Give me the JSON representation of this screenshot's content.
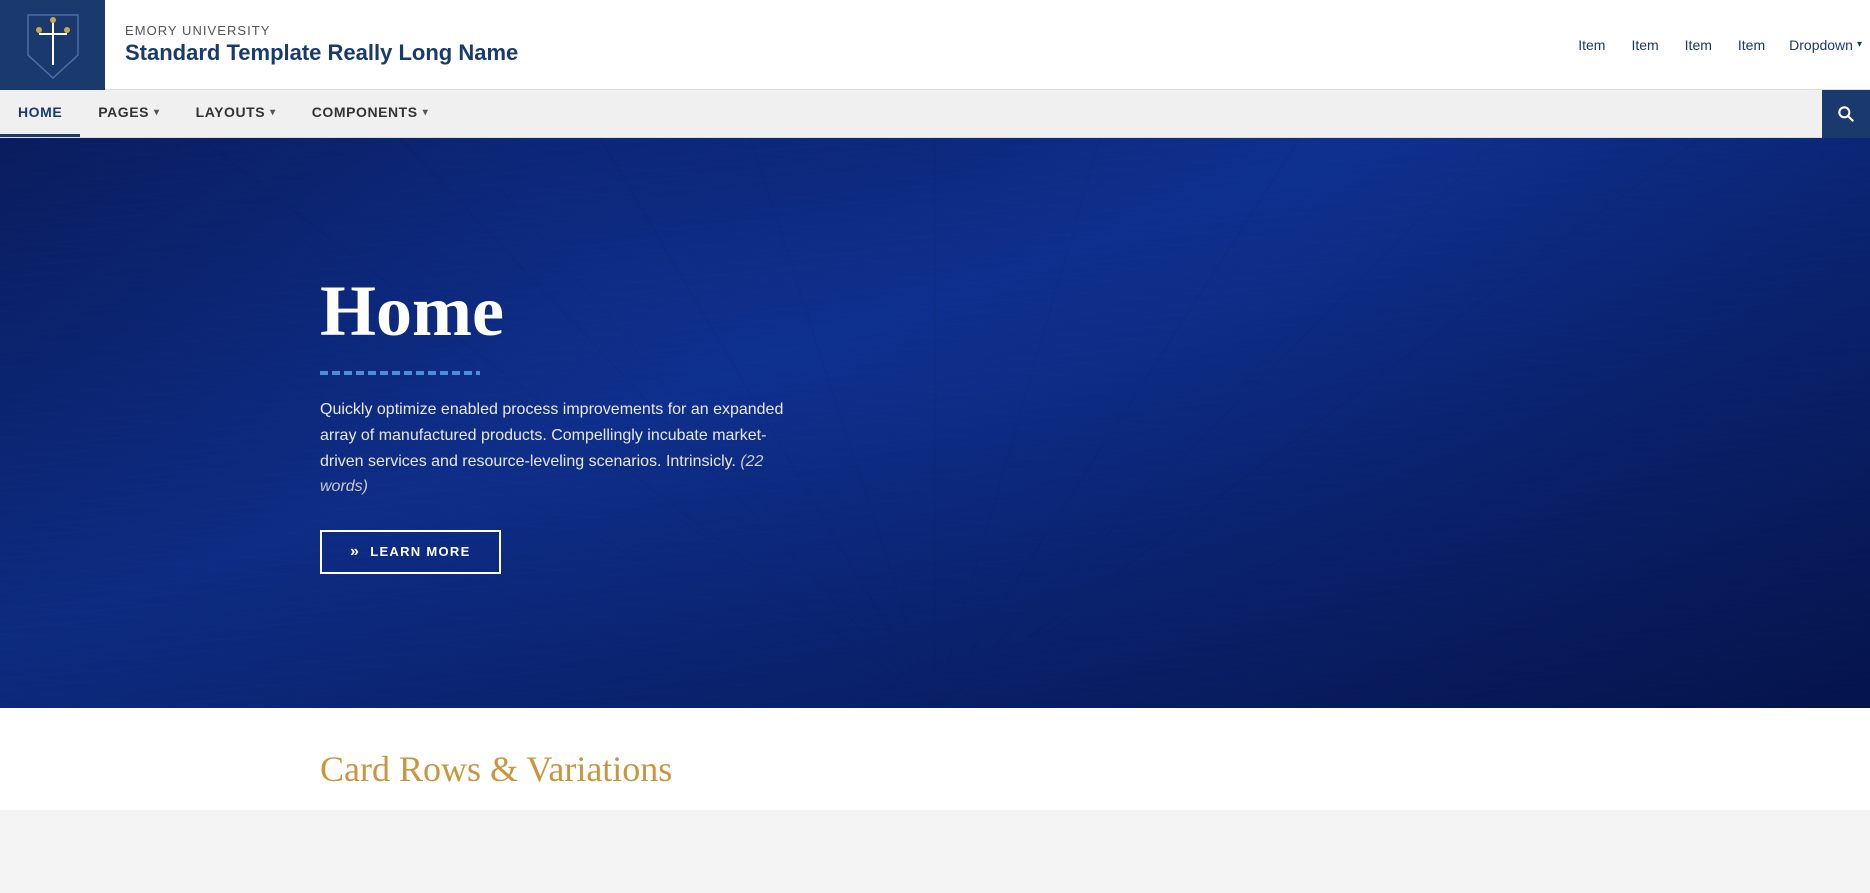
{
  "brand": {
    "university": "EMORY UNIVERSITY",
    "title": "Standard Template Really Long Name"
  },
  "top_nav": {
    "items": [
      "Item",
      "Item",
      "Item",
      "Item"
    ],
    "dropdown_label": "Dropdown"
  },
  "secondary_nav": {
    "items": [
      {
        "label": "HOME",
        "active": true,
        "has_dropdown": false
      },
      {
        "label": "PAGES",
        "active": false,
        "has_dropdown": true
      },
      {
        "label": "LAYOUTS",
        "active": false,
        "has_dropdown": true
      },
      {
        "label": "COMPONENTS",
        "active": false,
        "has_dropdown": true
      }
    ],
    "search_aria": "Search"
  },
  "hero": {
    "title": "Home",
    "divider_aria": "decorative divider",
    "description": "Quickly optimize enabled process improvements for an expanded array of manufactured products. Compellingly incubate market-driven services and resource-leveling scenarios. Intrinsicly.",
    "description_word_count": "(22 words)",
    "button_label": "LEARN MORE"
  },
  "section": {
    "title": "Card Rows & Variations"
  },
  "icons": {
    "search": "🔍",
    "chevron_right": "»",
    "caret_down": "▾"
  }
}
